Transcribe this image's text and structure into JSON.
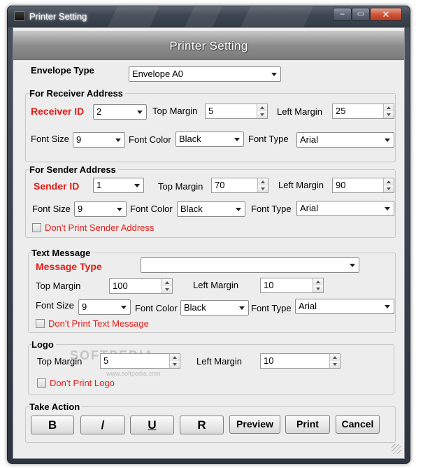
{
  "window": {
    "title": "Printer Setting",
    "controls": {
      "minimize": "‒",
      "maximize": "▭",
      "close": "✕"
    }
  },
  "header": {
    "title": "Printer Setting"
  },
  "watermark": {
    "text": "SOFTPEDIA",
    "url": "www.softpedia.com"
  },
  "envelope": {
    "label": "Envelope Type",
    "value": "Envelope A0"
  },
  "receiver": {
    "group_label": "For Receiver Address",
    "id_label": "Receiver ID",
    "id_value": "2",
    "top_margin_label": "Top Margin",
    "top_margin_value": "5",
    "left_margin_label": "Left Margin",
    "left_margin_value": "25",
    "font_size_label": "Font Size",
    "font_size_value": "9",
    "font_color_label": "Font Color",
    "font_color_value": "Black",
    "font_type_label": "Font Type",
    "font_type_value": "Arial"
  },
  "sender": {
    "group_label": "For Sender Address",
    "id_label": "Sender ID",
    "id_value": "1",
    "top_margin_label": "Top Margin",
    "top_margin_value": "70",
    "left_margin_label": "Left Margin",
    "left_margin_value": "90",
    "font_size_label": "Font Size",
    "font_size_value": "9",
    "font_color_label": "Font Color",
    "font_color_value": "Black",
    "font_type_label": "Font Type",
    "font_type_value": "Arial",
    "dont_print_label": "Don't  Print Sender Address"
  },
  "message": {
    "group_label": "Text Message",
    "type_label": "Message Type",
    "type_value": "",
    "top_margin_label": "Top Margin",
    "top_margin_value": "100",
    "left_margin_label": "Left Margin",
    "left_margin_value": "10",
    "font_size_label": "Font Size",
    "font_size_value": "9",
    "font_color_label": "Font Color",
    "font_color_value": "Black",
    "font_type_label": "Font Type",
    "font_type_value": "Arial",
    "dont_print_label": "Don't  Print Text Message"
  },
  "logo": {
    "group_label": "Logo",
    "top_margin_label": "Top Margin",
    "top_margin_value": "5",
    "left_margin_label": "Left Margin",
    "left_margin_value": "10",
    "dont_print_label": "Don't  Print Logo"
  },
  "actions": {
    "group_label": "Take Action",
    "bold": "B",
    "italic": "/",
    "underline": "U",
    "regular": "R",
    "preview": "Preview",
    "print": "Print",
    "cancel": "Cancel"
  }
}
